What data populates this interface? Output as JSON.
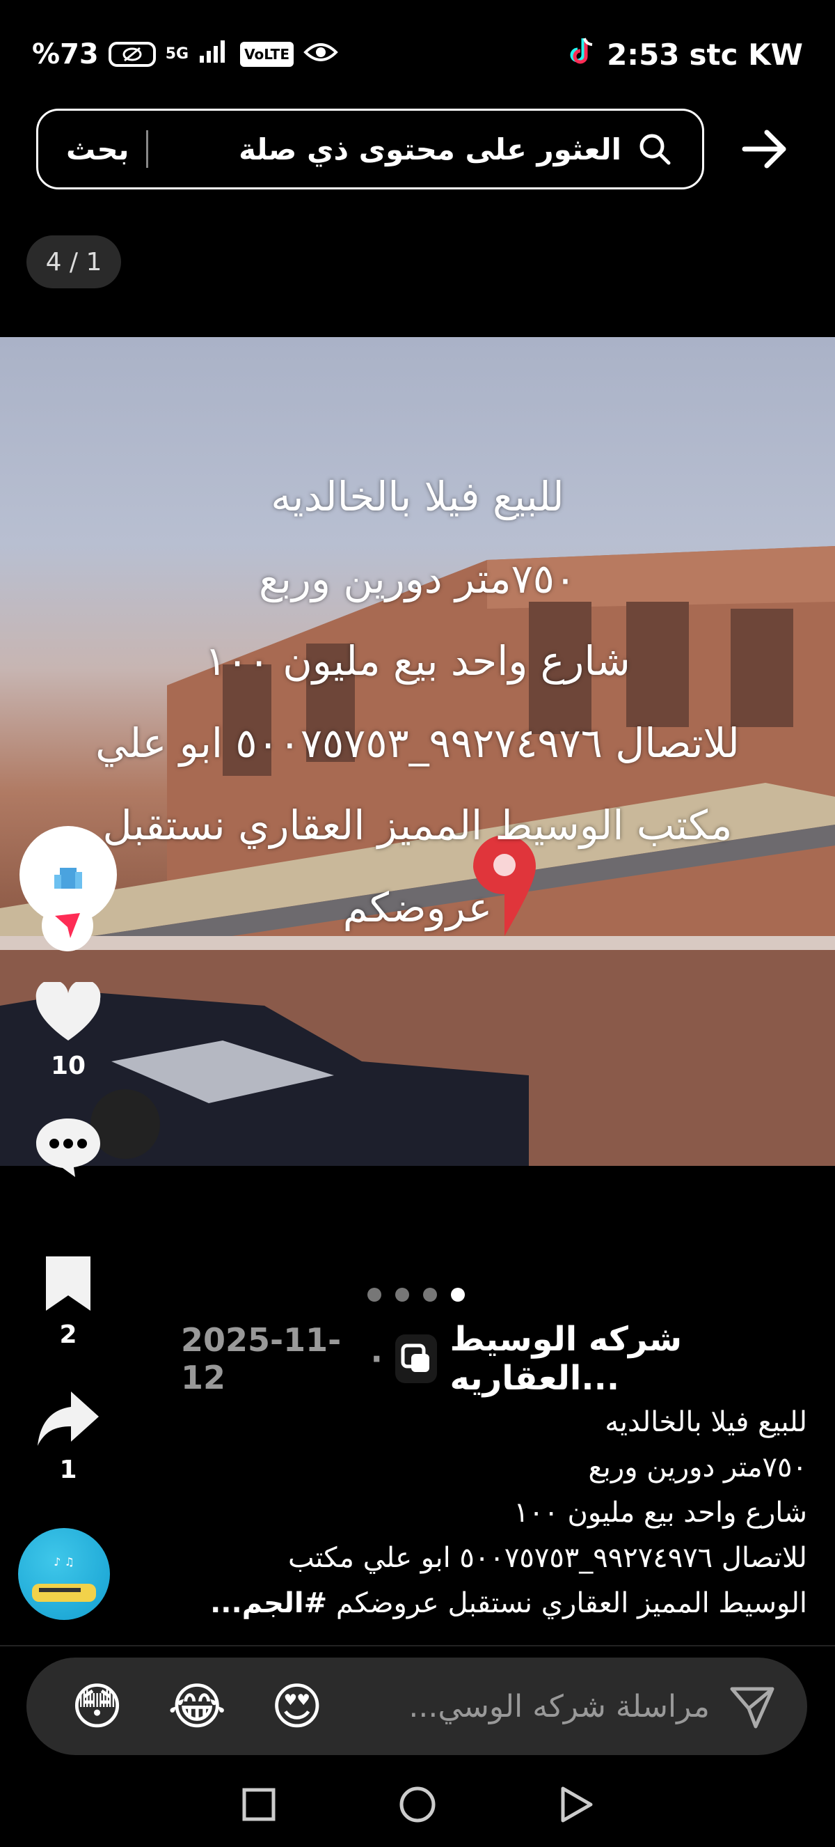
{
  "status_bar": {
    "battery": "%73",
    "network": "5G",
    "volte": "VoLTE",
    "time": "2:53",
    "carrier": "stc KW"
  },
  "search": {
    "query": "العثور على محتوى ذي صلة",
    "button_label": "بحث"
  },
  "page_counter": "4 / 1",
  "media": {
    "overlay_lines": [
      "للبيع فيلا بالخالديه",
      "٧٥٠متر دورين وربع",
      "شارع واحد بيع مليون ١٠٠",
      "للاتصال ٩٩٢٧٤٩٧٦_٥٠٠٧٥٧٥٣ ابو علي",
      "مكتب الوسيط المميز العقاري نستقبل",
      "عروضكم"
    ],
    "slide_count": 4,
    "active_slide": 4
  },
  "actions": {
    "likes": "10",
    "bookmarks": "2",
    "shares": "1"
  },
  "post": {
    "author": "شركه الوسيط العقاريه...",
    "date": "2025-11-12",
    "separator": "·",
    "caption_lines": [
      "للبيع فيلا بالخالديه",
      "٧٥٠متر دورين وربع",
      "شارع واحد بيع مليون ١٠٠",
      "للاتصال ٩٩٢٧٤٩٧٦_٥٠٠٧٥٧٥٣ ابو علي مكتب"
    ],
    "caption_last": "الوسيط المميز العقاري نستقبل عروضكم",
    "caption_hashtag": "#الجم..."
  },
  "reply": {
    "placeholder": "مراسلة شركه الوسي...",
    "emojis": [
      "😍",
      "😂",
      "😳"
    ]
  },
  "colors": {
    "background": "#000000",
    "reply_bar": "#2b2b2b",
    "pin": "#e0353b"
  }
}
